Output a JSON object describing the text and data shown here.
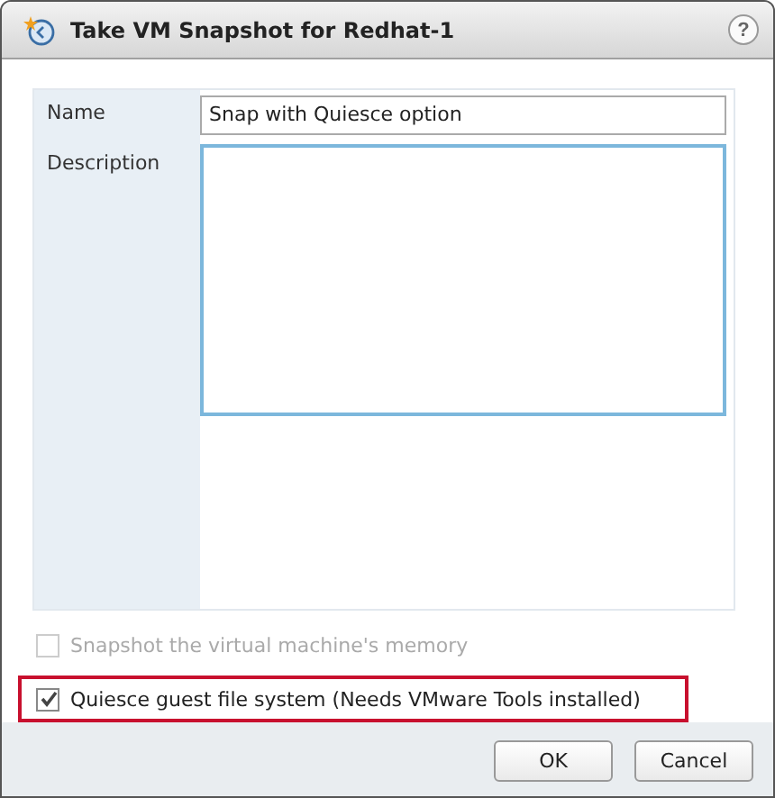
{
  "window": {
    "title": "Take VM Snapshot for Redhat-1",
    "help": "?"
  },
  "form": {
    "fields": [
      {
        "kind": "input",
        "label": "Name",
        "value": "Snap with Quiesce option"
      },
      {
        "kind": "textarea",
        "label": "Description",
        "focused": true
      }
    ]
  },
  "options": [
    {
      "label": "Snapshot the virtual machine's memory",
      "checked": false,
      "disabled": true,
      "highlighted": false
    },
    {
      "label": "Quiesce guest file system (Needs VMware Tools installed)",
      "checked": true,
      "disabled": false,
      "highlighted": true
    }
  ],
  "buttons": [
    "OK",
    "Cancel"
  ]
}
